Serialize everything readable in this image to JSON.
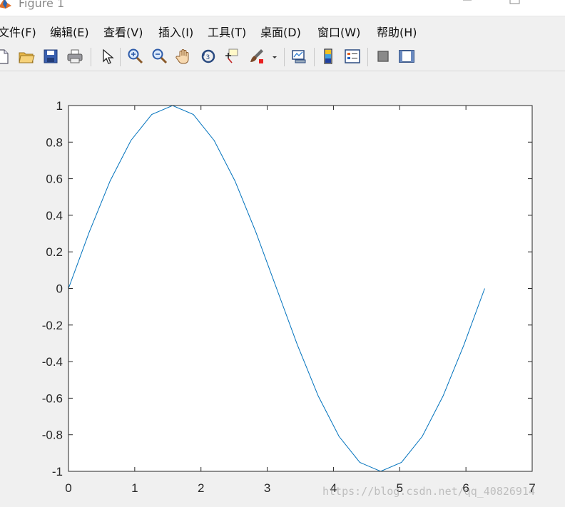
{
  "window": {
    "title": "Figure 1"
  },
  "menu": {
    "items": [
      {
        "label": "文件(F)"
      },
      {
        "label": "编辑(E)"
      },
      {
        "label": "查看(V)"
      },
      {
        "label": "插入(I)"
      },
      {
        "label": "工具(T)"
      },
      {
        "label": "桌面(D)"
      },
      {
        "label": "窗口(W)"
      },
      {
        "label": "帮助(H)"
      }
    ]
  },
  "toolbar": {
    "icons": [
      "new-figure-icon",
      "open-file-icon",
      "save-icon",
      "print-icon",
      "pointer-icon",
      "zoom-in-icon",
      "zoom-out-icon",
      "pan-hand-icon",
      "rotate-3d-icon",
      "data-cursor-icon",
      "brush-icon",
      "brush-dropdown-icon",
      "link-plot-icon",
      "colorbar-icon",
      "legend-icon",
      "hide-plot-tools-icon",
      "show-plot-tools-icon"
    ]
  },
  "watermark": "https://blog.csdn.net/qq_40826914",
  "colors": {
    "line": "#0072bd",
    "axes_bg": "#ffffff",
    "figure_bg": "#f0f0f0"
  },
  "chart_data": {
    "type": "line",
    "title": "",
    "xlabel": "",
    "ylabel": "",
    "xlim": [
      0,
      7
    ],
    "ylim": [
      -1,
      1
    ],
    "xticks": [
      0,
      1,
      2,
      3,
      4,
      5,
      6,
      7
    ],
    "yticks": [
      -1,
      -0.8,
      -0.6,
      -0.4,
      -0.2,
      0,
      0.2,
      0.4,
      0.6,
      0.8,
      1
    ],
    "grid": false,
    "series": [
      {
        "color": "#0072bd",
        "x": [
          0,
          0.3142,
          0.6283,
          0.9425,
          1.2566,
          1.5708,
          1.885,
          2.1991,
          2.5133,
          2.8274,
          3.1416,
          3.4558,
          3.7699,
          4.0841,
          4.3982,
          4.7124,
          5.0265,
          5.3407,
          5.6549,
          5.969,
          6.2832
        ],
        "y": [
          0,
          0.309,
          0.5878,
          0.809,
          0.9511,
          1,
          0.9511,
          0.809,
          0.5878,
          0.309,
          0,
          -0.309,
          -0.5878,
          -0.809,
          -0.9511,
          -1,
          -0.9511,
          -0.809,
          -0.5878,
          -0.309,
          0
        ]
      }
    ]
  }
}
